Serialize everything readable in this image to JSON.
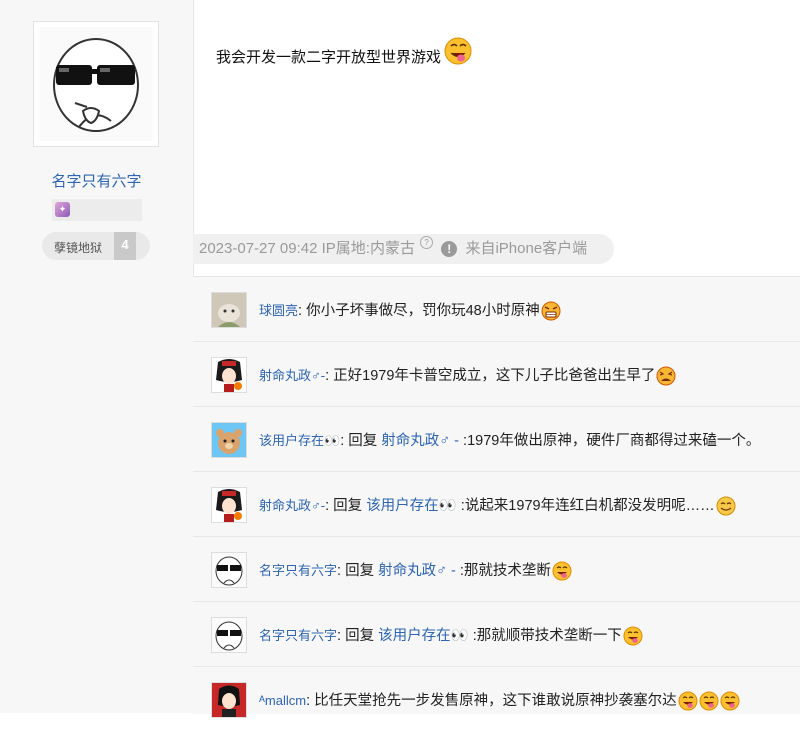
{
  "author": {
    "name": "名字只有六字",
    "level_name": "孽镜地狱",
    "level_number": "4"
  },
  "post": {
    "text": "我会开发一款二字开放型世界游戏",
    "meta": {
      "time": "2023-07-27 09:42",
      "ip": "IP属地:内蒙古",
      "source": "来自iPhone客户端"
    }
  },
  "comments": [
    {
      "user": "球圆亮",
      "sep": ": ",
      "pre": "",
      "reply_to": "",
      "post": "",
      "text": "你小子坏事做尽，罚你玩48小时原神",
      "emojis": [
        "angry"
      ]
    },
    {
      "user": "射命丸政♂-",
      "sep": ": ",
      "pre": "",
      "reply_to": "",
      "post": "",
      "text": "正好1979年卡普空成立，这下儿子比爸爸出生早了",
      "emojis": [
        "scared"
      ]
    },
    {
      "user": "该用户存在👀",
      "sep": ": ",
      "pre": "回复 ",
      "reply_to": "射命丸政♂ -",
      "post": " :",
      "text": "1979年做出原神，硬件厂商都得过来磕一个。",
      "emojis": []
    },
    {
      "user": "射命丸政♂-",
      "sep": ": ",
      "pre": "回复 ",
      "reply_to": "该用户存在👀",
      "post": " :",
      "text": "说起来1979年连红白机都没发明呢……",
      "emojis": [
        "smile"
      ]
    },
    {
      "user": "名字只有六字",
      "sep": ": ",
      "pre": "回复 ",
      "reply_to": "射命丸政♂ -",
      "post": " :",
      "text": "那就技术垄断",
      "emojis": [
        "tongue"
      ]
    },
    {
      "user": "名字只有六字",
      "sep": ": ",
      "pre": "回复 ",
      "reply_to": "该用户存在👀",
      "post": " :",
      "text": "那就顺带技术垄断一下",
      "emojis": [
        "tongue"
      ]
    },
    {
      "user": "ᴬmallcm",
      "sep": ": ",
      "pre": "",
      "reply_to": "",
      "post": "",
      "text": "比任天堂抢先一步发售原神，这下谁敢说原神抄袭塞尔达",
      "emojis": [
        "tongue",
        "tongue",
        "tongue"
      ]
    }
  ]
}
